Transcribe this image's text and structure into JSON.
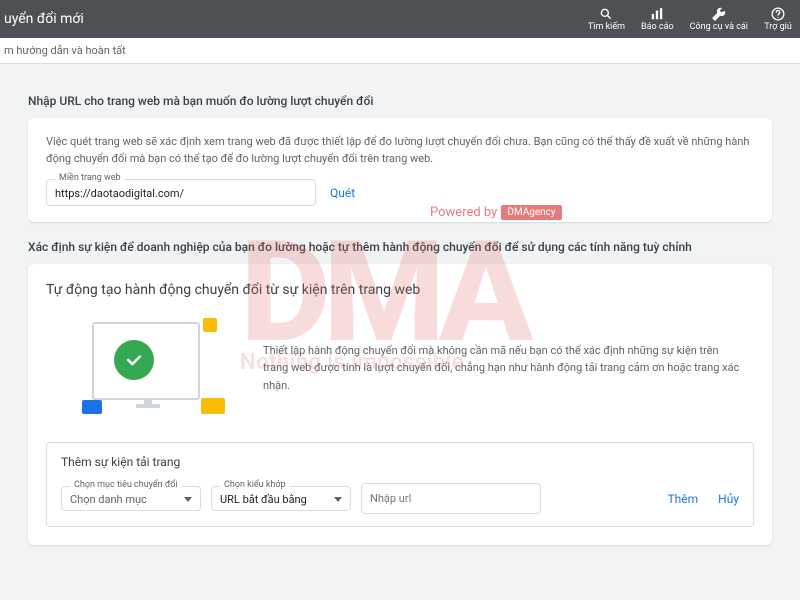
{
  "topbar": {
    "title": "uyển đổi mới",
    "actions": {
      "search": "Tìm kiếm",
      "reports": "Báo cáo",
      "tools": "Công cụ và cái",
      "help": "Trợ giú"
    }
  },
  "subbar": "m hướng dẫn và hoàn tất",
  "section1": {
    "label": "Nhập URL cho trang web mà bạn muốn đo lường lượt chuyển đổi",
    "desc": "Việc quét trang web sẽ xác định xem trang web đã được thiết lập để đo lường lượt chuyển đổi chưa. Bạn cũng có thể thấy đề xuất về những hành động chuyển đổi mà bạn có thể tạo để đo lường lượt chuyển đổi trên trang web.",
    "field_label": "Miền trang web",
    "field_value": "https://daotaodigital.com/",
    "scan": "Quét"
  },
  "section2": {
    "label": "Xác định sự kiện để doanh nghiệp của bạn đo lường hoặc tự thêm hành động chuyển đổi để sử dụng các tính năng tuỳ chỉnh",
    "auto_title": "Tự động tạo hành động chuyển đổi từ sự kiện trên trang web",
    "auto_desc": "Thiết lập hành động chuyển đổi mà không cần mã nếu bạn có thể xác định những sự kiện trên trang web được tính là lượt chuyển đổi, chẳng hạn như hành động tải trang cảm ơn hoặc trang xác nhận."
  },
  "event_box": {
    "title": "Thêm sự kiện tải trang",
    "cat_label": "Chọn mục tiêu chuyển đổi",
    "cat_value": "Chọn danh mục",
    "match_label": "Chọn kiểu khớp",
    "match_value": "URL bắt đầu bằng",
    "url_placeholder": "Nhập url",
    "add": "Thêm",
    "cancel": "Hủy"
  },
  "watermark": {
    "powered": "Powered by",
    "brand": "DMAgency",
    "big": "DMA",
    "slogan": "Nothing is impossible"
  }
}
